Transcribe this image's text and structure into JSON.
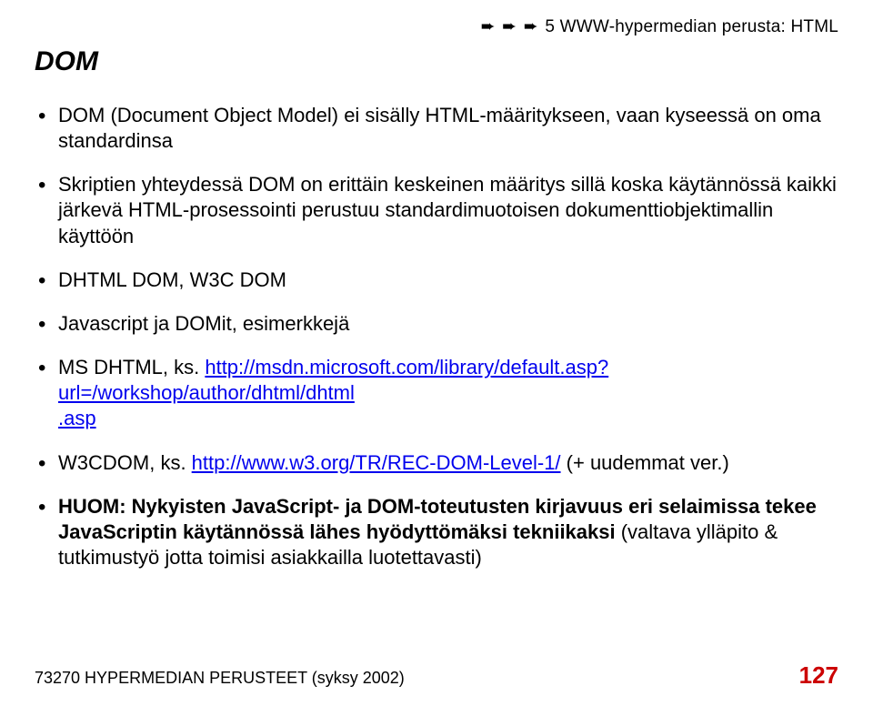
{
  "breadcrumb": {
    "arrow": "➨",
    "text": "5 WWW-hypermedian perusta: HTML"
  },
  "title": "DOM",
  "bullets": {
    "b1": "DOM (Document Object Model) ei sisälly HTML-määritykseen, vaan kyseessä on oma standardinsa",
    "b2": "Skriptien yhteydessä DOM on erittäin keskeinen määritys sillä koska käytännössä kaikki järkevä HTML-prosessointi perustuu standardimuotoisen dokumenttiobjektimallin käyttöön",
    "b3": "DHTML DOM, W3C DOM",
    "b4": "Javascript ja DOMit, esimerkkejä",
    "b5a": "MS DHTML, ks. ",
    "b5link1": "http://msdn.microsoft.com/library/default.asp?url=/workshop/author/dhtml/dhtml",
    "b5link2": ".asp",
    "b6a": "W3CDOM, ks. ",
    "b6link": "http://www.w3.org/TR/REC-DOM-Level-1/",
    "b6b": " (+ uudemmat ver.)",
    "b7a": "HUOM: Nykyisten JavaScript- ja DOM-toteutusten kirjavuus eri selaimissa tekee JavaScriptin käytännössä lähes hyödyttömäksi tekniikaksi",
    "b7b": " (valtava ylläpito & tutkimustyö jotta toimisi asiakkailla luotettavasti)"
  },
  "footer": {
    "left": "73270 HYPERMEDIAN PERUSTEET (syksy 2002)",
    "page": "127"
  }
}
